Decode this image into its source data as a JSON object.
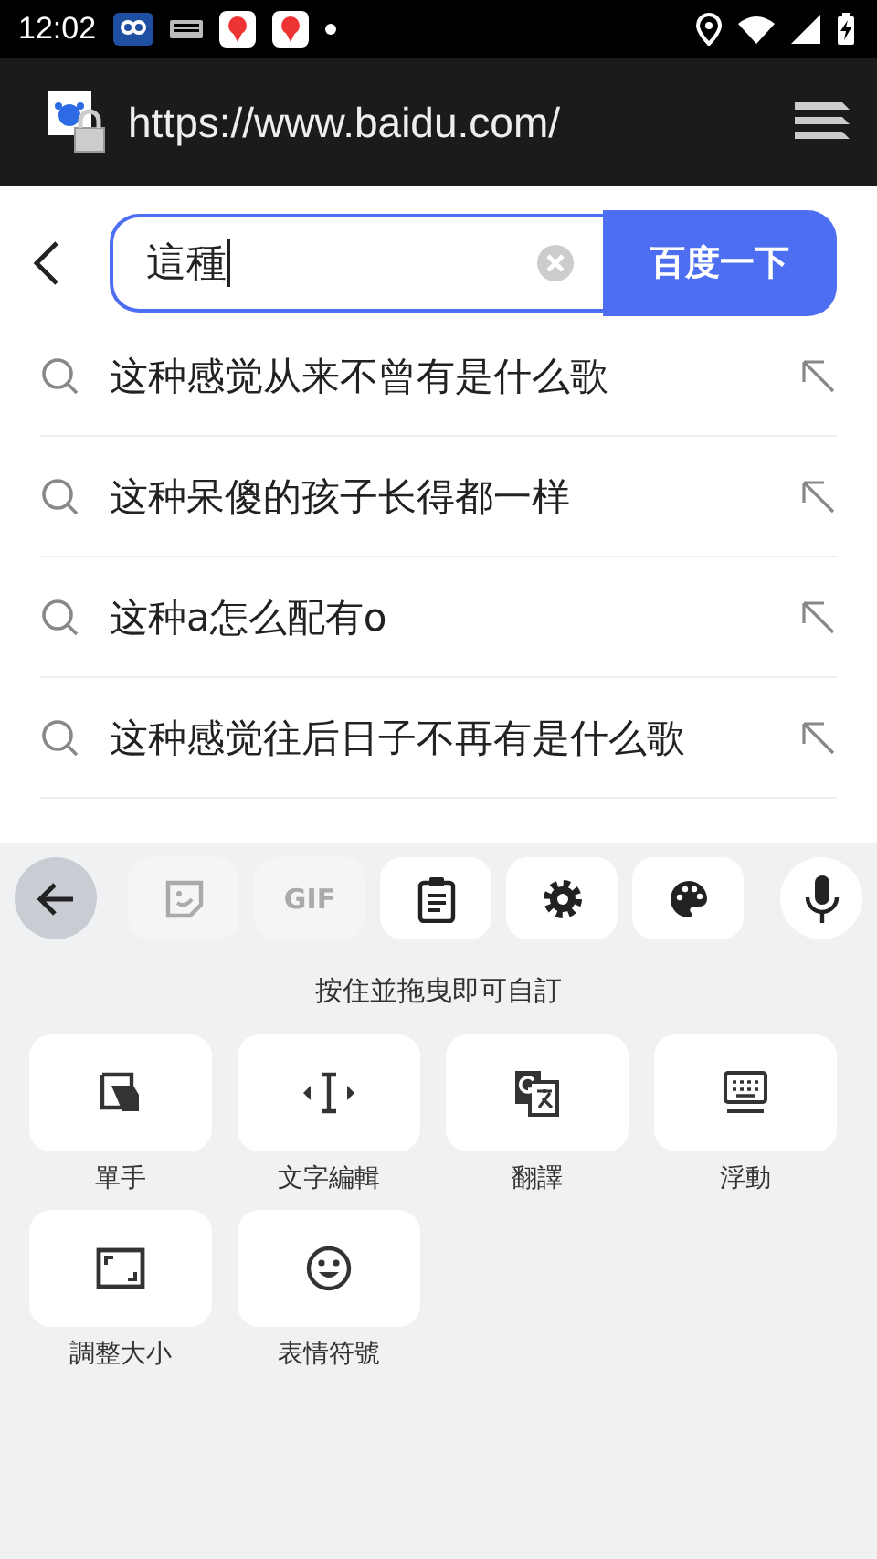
{
  "status_bar": {
    "time": "12:02"
  },
  "address_bar": {
    "url": "https://www.baidu.com/"
  },
  "search": {
    "value": "這種",
    "button": "百度一下"
  },
  "suggestions": [
    {
      "text": "这种感觉从来不曾有是什么歌"
    },
    {
      "text": "这种呆傻的孩子长得都一样"
    },
    {
      "text": "这种a怎么配有o"
    },
    {
      "text": "这种感觉往后日子不再有是什么歌"
    }
  ],
  "keyboard_toolbar": [
    {
      "kind": "back",
      "selected": true,
      "disabled": false
    },
    {
      "kind": "sticker",
      "selected": false,
      "disabled": true
    },
    {
      "kind": "gif",
      "label": "GIF",
      "selected": false,
      "disabled": true
    },
    {
      "kind": "clipboard",
      "selected": false,
      "disabled": false
    },
    {
      "kind": "settings",
      "selected": false,
      "disabled": false
    },
    {
      "kind": "palette",
      "selected": false,
      "disabled": false
    },
    {
      "kind": "mic",
      "selected": false,
      "disabled": false
    }
  ],
  "hint": "按住並拖曳即可自訂",
  "tiles": [
    {
      "kind": "one-hand",
      "label": "單手"
    },
    {
      "kind": "text-edit",
      "label": "文字編輯"
    },
    {
      "kind": "translate",
      "label": "翻譯"
    },
    {
      "kind": "floating",
      "label": "浮動"
    },
    {
      "kind": "resize",
      "label": "調整大小"
    },
    {
      "kind": "emoji",
      "label": "表情符號"
    }
  ]
}
